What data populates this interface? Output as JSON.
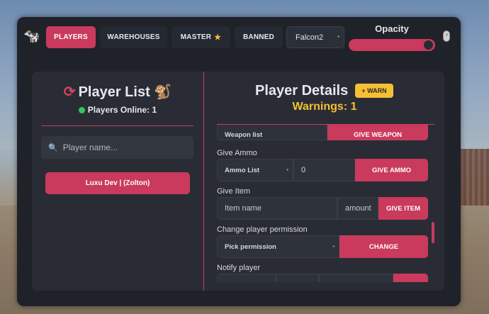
{
  "header": {
    "logo_icon": "animal-logo-icon",
    "tabs": [
      {
        "label": "PLAYERS",
        "active": true
      },
      {
        "label": "WAREHOUSES",
        "active": false
      },
      {
        "label": "MASTER",
        "active": false,
        "icon": "star-icon"
      },
      {
        "label": "BANNED",
        "active": false
      }
    ],
    "server_select": "Falcon2",
    "opacity_label": "Opacity",
    "opacity_value": 1.0
  },
  "player_list": {
    "title": "Player List",
    "title_icon": "sync-icon",
    "title_emoji": "🐒",
    "online_label": "Players Online: 1",
    "search_placeholder": "Player name...",
    "players": [
      "Luxu Dev | (Zolton)"
    ]
  },
  "player_details": {
    "title": "Player Details",
    "warn_button": "+ WARN",
    "warnings_label": "Warnings: 1",
    "cut_row_left": "Weapon list",
    "cut_row_button": "GIVE WEAPON",
    "give_ammo": {
      "label": "Give Ammo",
      "select": "Ammo List",
      "value": "0",
      "button": "GIVE AMMO"
    },
    "give_item": {
      "label": "Give Item",
      "item_placeholder": "Item name",
      "amount_placeholder": "amount",
      "button": "GIVE ITEM"
    },
    "permission": {
      "label": "Change player permission",
      "select": "Pick permission",
      "button": "CHANGE"
    },
    "notify": {
      "label": "Notify player"
    }
  },
  "colors": {
    "accent": "#c93a5d",
    "warning": "#f5c033",
    "online": "#34c759",
    "panel": "#1f2229"
  }
}
